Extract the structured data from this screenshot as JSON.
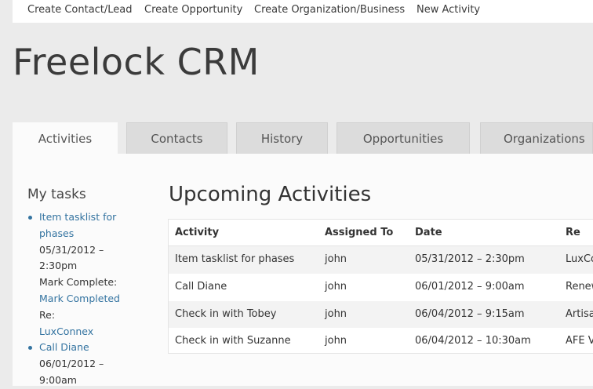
{
  "top_nav": {
    "items": [
      "Create Contact/Lead",
      "Create Opportunity",
      "Create Organization/Business",
      "New Activity"
    ]
  },
  "site_title": "Freelock CRM",
  "tabs": [
    "Activities",
    "Contacts",
    "History",
    "Opportunities",
    "Organizations"
  ],
  "active_tab": "Activities",
  "sidebar": {
    "title": "My tasks",
    "tasks": [
      {
        "name": "Item tasklist for phases",
        "date": "05/31/2012 – 2:30pm",
        "mark_label": "Mark Complete:",
        "mark_link": "Mark Completed",
        "re_label": "Re:",
        "re_link": "LuxConnex"
      },
      {
        "name": "Call Diane",
        "date": "06/01/2012 – 9:00am"
      }
    ]
  },
  "main": {
    "title": "Upcoming Activities",
    "columns": [
      "Activity",
      "Assigned To",
      "Date",
      "Re"
    ],
    "rows": [
      {
        "activity": "Item tasklist for phases",
        "assigned": "john",
        "date": "05/31/2012 – 2:30pm",
        "re": "LuxConnex"
      },
      {
        "activity": "Call Diane",
        "assigned": "john",
        "date": "06/01/2012 – 9:00am",
        "re": "Renew"
      },
      {
        "activity": "Check in with Tobey",
        "assigned": "john",
        "date": "06/04/2012 – 9:15am",
        "re": "Artisan"
      },
      {
        "activity": "Check in with Suzanne",
        "assigned": "john",
        "date": "06/04/2012 – 10:30am",
        "re": "AFE V"
      }
    ]
  },
  "colors": {
    "link": "#3373a0",
    "page_bg": "#ebebeb",
    "content_bg": "#fbfbfb",
    "tab_bg": "#dcdcdc"
  }
}
